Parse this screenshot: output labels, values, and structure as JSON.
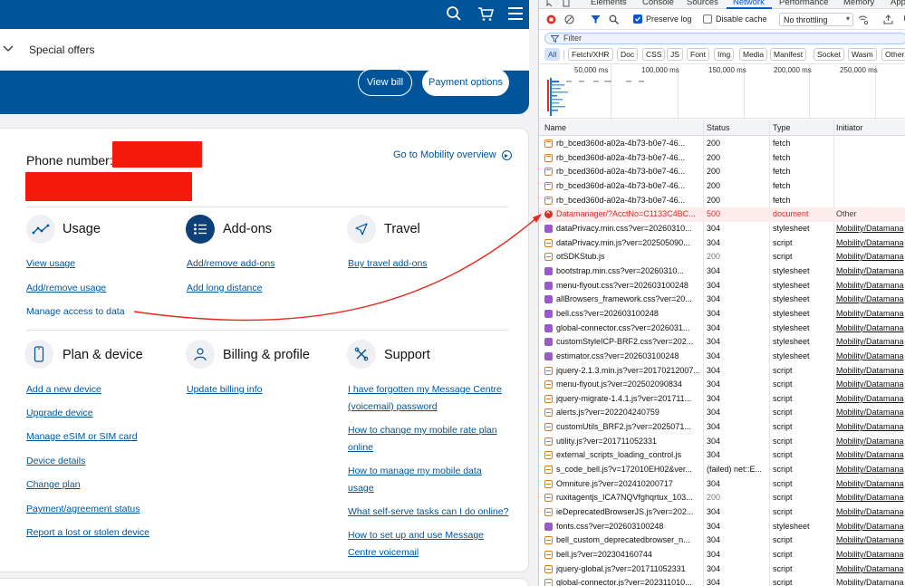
{
  "site": {
    "subnav": {
      "special_offers": "Special offers"
    },
    "buttons": {
      "view_bill": "View bill",
      "payment_options": "Payment options"
    },
    "account": {
      "phone_label": "Phone number:",
      "mobility_link": "Go to Mobility overview"
    },
    "sections": [
      {
        "title": "Usage",
        "icon": "usage-chart-icon",
        "links": [
          "View usage",
          "Add/remove usage",
          "Manage access to data"
        ]
      },
      {
        "title": "Add-ons",
        "icon": "add-ons-list-icon",
        "links": [
          "Add/remove add-ons",
          "Add long distance"
        ]
      },
      {
        "title": "Travel",
        "icon": "travel-plane-icon",
        "links": [
          "Buy travel add-ons"
        ]
      },
      {
        "title": "Plan & device",
        "icon": "phone-device-icon",
        "links": [
          "Add a new device",
          "Upgrade device",
          "Manage eSIM or SIM card",
          "Device details",
          "Change plan",
          "Payment/agreement status",
          "Report a lost or stolen device"
        ]
      },
      {
        "title": "Billing & profile",
        "icon": "profile-person-icon",
        "links": [
          "Update billing info"
        ]
      },
      {
        "title": "Support",
        "icon": "support-tools-icon",
        "links": [
          "I have forgotten my Message Centre",
          "(voicemail) password",
          "How to change my mobile rate plan",
          "online",
          "How to manage my mobile data",
          "usage",
          "What self-serve tasks can I do online?",
          "How to set up and use Message",
          "Centre voicemail"
        ]
      }
    ],
    "colors": {
      "brand": "#00549a",
      "redaction": "#f31a0b",
      "arrow": "#e8291c"
    }
  },
  "devtools": {
    "tabs": [
      "Elements",
      "Console",
      "Sources",
      "Network",
      "Performance",
      "Memory",
      "App"
    ],
    "active_tab": "Network",
    "toolbar": {
      "preserve_log": "Preserve log",
      "preserve_log_checked": true,
      "disable_cache": "Disable cache",
      "disable_cache_checked": false,
      "throttling": "No throttling"
    },
    "filter_placeholder": "Filter",
    "type_filters": [
      "All",
      "Fetch/XHR",
      "Doc",
      "CSS",
      "JS",
      "Font",
      "Img",
      "Media",
      "Manifest",
      "Socket",
      "Wasm",
      "Other"
    ],
    "timeline_ticks": [
      "50,000 ms",
      "100,000 ms",
      "150,000 ms",
      "200,000 ms",
      "250,000 ms"
    ],
    "columns": [
      "Name",
      "Status",
      "Type",
      "Initiator"
    ],
    "rows": [
      {
        "name": "rb_bced360d-a02a-4b73-b0e7-46...",
        "status": "200",
        "type": "fetch",
        "initiator": "",
        "icon": "xhr"
      },
      {
        "name": "rb_bced360d-a02a-4b73-b0e7-46...",
        "status": "200",
        "type": "fetch",
        "initiator": "",
        "icon": "xhr"
      },
      {
        "name": "rb_bced360d-a02a-4b73-b0e7-46...",
        "status": "200",
        "type": "fetch",
        "initiator": "",
        "icon": "xhr"
      },
      {
        "name": "rb_bced360d-a02a-4b73-b0e7-46...",
        "status": "200",
        "type": "fetch",
        "initiator": "",
        "icon": "xhr"
      },
      {
        "name": "rb_bced360d-a02a-4b73-b0e7-46...",
        "status": "200",
        "type": "fetch",
        "initiator": "",
        "icon": "xhr"
      },
      {
        "name": "Datamanager/?AcctNo=C1133C4BC...",
        "status": "500",
        "type": "document",
        "initiator": "Other",
        "icon": "error"
      },
      {
        "name": "dataPrivacy.min.css?ver=20260310...",
        "status": "304",
        "type": "stylesheet",
        "initiator": "Mobility/Datamana",
        "icon": "css"
      },
      {
        "name": "dataPrivacy.min.js?ver=202505090...",
        "status": "304",
        "type": "script",
        "initiator": "Mobility/Datamana",
        "icon": "js"
      },
      {
        "name": "otSDKStub.js",
        "status": "200",
        "type": "script",
        "initiator": "Mobility/Datamana",
        "icon": "js"
      },
      {
        "name": "bootstrap.min.css?ver=20260310...",
        "status": "304",
        "type": "stylesheet",
        "initiator": "Mobility/Datamana",
        "icon": "css"
      },
      {
        "name": "menu-flyout.css?ver=202603100248",
        "status": "304",
        "type": "stylesheet",
        "initiator": "Mobility/Datamana",
        "icon": "css"
      },
      {
        "name": "allBrowsers_framework.css?ver=20...",
        "status": "304",
        "type": "stylesheet",
        "initiator": "Mobility/Datamana",
        "icon": "css"
      },
      {
        "name": "bell.css?ver=202603100248",
        "status": "304",
        "type": "stylesheet",
        "initiator": "Mobility/Datamana",
        "icon": "css"
      },
      {
        "name": "global-connector.css?ver=2026031...",
        "status": "304",
        "type": "stylesheet",
        "initiator": "Mobility/Datamana",
        "icon": "css"
      },
      {
        "name": "customStyleICP-BRF2.css?ver=202...",
        "status": "304",
        "type": "stylesheet",
        "initiator": "Mobility/Datamana",
        "icon": "css"
      },
      {
        "name": "estimator.css?ver=202603100248",
        "status": "304",
        "type": "stylesheet",
        "initiator": "Mobility/Datamana",
        "icon": "css"
      },
      {
        "name": "jquery-2.1.3.min.js?ver=20170212007...",
        "status": "304",
        "type": "script",
        "initiator": "Mobility/Datamana",
        "icon": "js"
      },
      {
        "name": "menu-flyout.js?ver=202502090834",
        "status": "304",
        "type": "script",
        "initiator": "Mobility/Datamana",
        "icon": "js"
      },
      {
        "name": "jquery-migrate-1.4.1.js?ver=201711...",
        "status": "304",
        "type": "script",
        "initiator": "Mobility/Datamana",
        "icon": "js"
      },
      {
        "name": "alerts.js?ver=202204240759",
        "status": "304",
        "type": "script",
        "initiator": "Mobility/Datamana",
        "icon": "js"
      },
      {
        "name": "customUtils_BRF2.js?ver=2025071...",
        "status": "304",
        "type": "script",
        "initiator": "Mobility/Datamana",
        "icon": "js"
      },
      {
        "name": "utility.js?ver=201711052331",
        "status": "304",
        "type": "script",
        "initiator": "Mobility/Datamana",
        "icon": "js"
      },
      {
        "name": "external_scripts_loading_control.js",
        "status": "304",
        "type": "script",
        "initiator": "Mobility/Datamana",
        "icon": "js"
      },
      {
        "name": "s_code_bell.js?v=172010EH02&ver...",
        "status": "(failed) net::E...",
        "type": "script",
        "initiator": "Mobility/Datamana",
        "icon": "js"
      },
      {
        "name": "Omniture.js?ver=202410200717",
        "status": "304",
        "type": "script",
        "initiator": "Mobility/Datamana",
        "icon": "js"
      },
      {
        "name": "ruxitagentjs_ICA7NQVfghqrtux_103...",
        "status": "200",
        "type": "script",
        "initiator": "Mobility/Datamana",
        "icon": "js"
      },
      {
        "name": "ieDeprecatedBrowserJS.js?ver=202...",
        "status": "304",
        "type": "script",
        "initiator": "Mobility/Datamana",
        "icon": "js"
      },
      {
        "name": "fonts.css?ver=202603100248",
        "status": "304",
        "type": "stylesheet",
        "initiator": "Mobility/Datamana",
        "icon": "css"
      },
      {
        "name": "bell_custom_deprecatedbrowser_n...",
        "status": "304",
        "type": "script",
        "initiator": "Mobility/Datamana",
        "icon": "js"
      },
      {
        "name": "bell.js?ver=202304160744",
        "status": "304",
        "type": "script",
        "initiator": "Mobility/Datamana",
        "icon": "js"
      },
      {
        "name": "jquery-global.js?ver=201711052331",
        "status": "304",
        "type": "script",
        "initiator": "Mobility/Datamana",
        "icon": "js"
      },
      {
        "name": "global-connector.js?ver=202311010...",
        "status": "304",
        "type": "script",
        "initiator": "Mobility/Datamana",
        "icon": "js"
      }
    ]
  }
}
